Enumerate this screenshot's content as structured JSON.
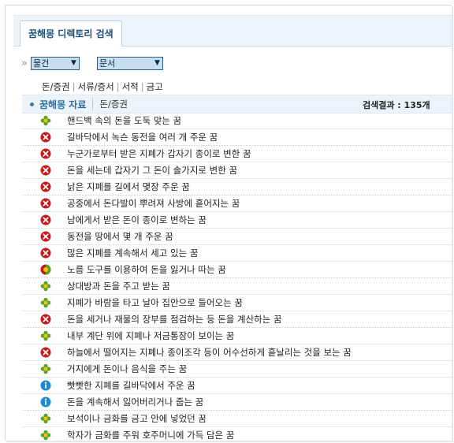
{
  "tab": {
    "label": "꿈해몽 디렉토리 검색"
  },
  "filters": {
    "prefix": "»",
    "select1": "물건",
    "select2": "문서"
  },
  "categories": [
    "돈/증권",
    "서류/증서",
    "서적",
    "금고"
  ],
  "list_header": {
    "title": "꿈해몽 자료",
    "crumb": "돈/증권",
    "result": "검색결과 : 135개"
  },
  "icons": {
    "good": {
      "name": "flower-good-icon",
      "color": "#5aa02c"
    },
    "bad": {
      "name": "x-bad-icon",
      "color": "#c41a1a"
    },
    "mixed": {
      "name": "half-mixed-icon",
      "color": "#e0a000"
    },
    "neutral": {
      "name": "info-neutral-icon",
      "color": "#1e8ad6"
    }
  },
  "items": [
    {
      "text": "핸드백 속의 돈을 도둑 맞는 꿈",
      "type": "good"
    },
    {
      "text": "길바닥에서 녹슨 동전을 여러 개 주운 꿈",
      "type": "bad"
    },
    {
      "text": "누군가로부터 받은 지폐가 갑자기 종이로 변한 꿈",
      "type": "bad"
    },
    {
      "text": "돈을 세는데 갑자기 그 돈이 솔가지로 변한 꿈",
      "type": "bad"
    },
    {
      "text": "낡은 지폐를 길에서 몇장 주운 꿈",
      "type": "bad"
    },
    {
      "text": "공중에서 돈다발이 뿌려져 사방에 흩어지는 꿈",
      "type": "bad"
    },
    {
      "text": "남에게서 받은 돈이 종이로 변하는 꿈",
      "type": "bad"
    },
    {
      "text": "동전을 땅에서 몇 개 주운 꿈",
      "type": "bad"
    },
    {
      "text": "많은 지폐를 계속해서 세고 있는 꿈",
      "type": "bad"
    },
    {
      "text": "노름 도구를 이용하여 돈을 잃거나 따는 꿈",
      "type": "mixed"
    },
    {
      "text": "상대방과 돈을 주고 받는 꿈",
      "type": "good"
    },
    {
      "text": "지폐가 바람을 타고 날아 집안으로 들어오는 꿈",
      "type": "good"
    },
    {
      "text": "돈을 세거나 재물의 장부를 점검하는 등 돈을 계산하는 꿈",
      "type": "bad"
    },
    {
      "text": "내부 계단 위에 지폐나 저금통장이 보이는 꿈",
      "type": "good"
    },
    {
      "text": "하늘에서 떨어지는 지폐나 종이조각 등이 어수선하게 흩날리는 것을 보는 꿈",
      "type": "bad"
    },
    {
      "text": "거지에게 돈이나 음식을 주는 꿈",
      "type": "good"
    },
    {
      "text": "빳빳한 지폐를 길바닥에서 주운 꿈",
      "type": "neutral"
    },
    {
      "text": "돈을 계속해서 잃어버리거나 줍는 꿈",
      "type": "neutral"
    },
    {
      "text": "보석이나 금화를 금고 안에 넣었던 꿈",
      "type": "good"
    },
    {
      "text": "학자가 금화를 주워 호주머니에 가득 담은 꿈",
      "type": "good"
    }
  ]
}
